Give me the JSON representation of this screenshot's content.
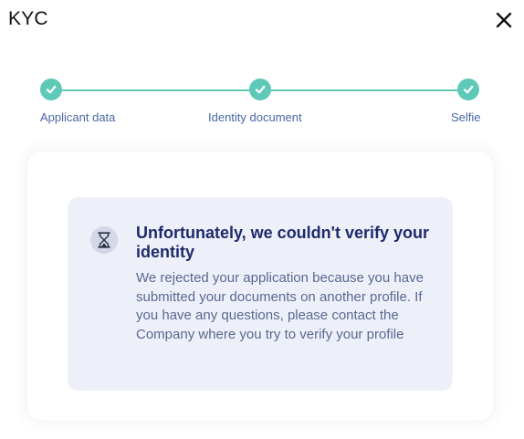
{
  "window": {
    "title": "KYC",
    "close_icon": "close-icon"
  },
  "stepper": {
    "accent_color": "#5fc9b8",
    "steps": [
      {
        "label": "Applicant data",
        "status": "completed",
        "icon": "check-icon"
      },
      {
        "label": "Identity document",
        "status": "completed",
        "icon": "check-icon"
      },
      {
        "label": "Selfie",
        "status": "completed",
        "icon": "check-icon"
      }
    ]
  },
  "message": {
    "icon": "hourglass-icon",
    "title": "Unfortunately, we couldn't verify your identity",
    "body": "We rejected your application because you have submitted your documents on another profile. If you have any questions, please contact the Company where you try to verify your profile"
  }
}
